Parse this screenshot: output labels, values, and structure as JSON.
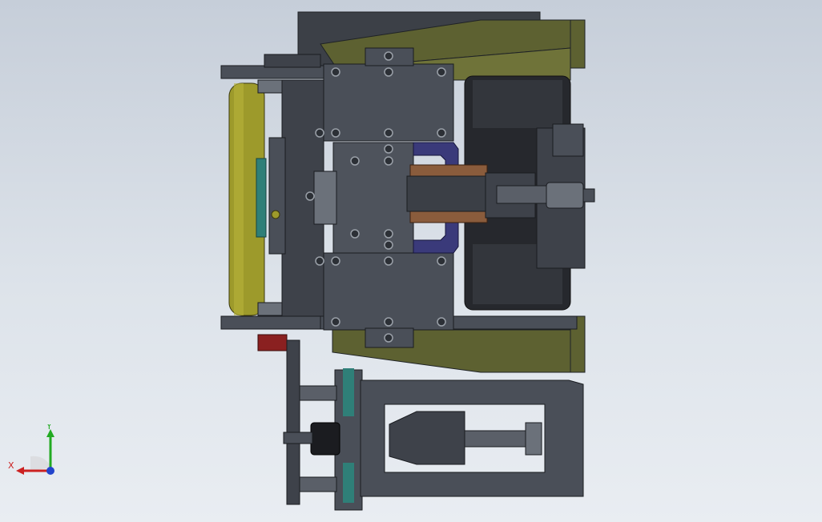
{
  "viewport": {
    "background_top": "#c6ced9",
    "background_bottom": "#e9edf2"
  },
  "model": {
    "colors": {
      "steel": "#4a4f58",
      "steel_dark": "#2c3036",
      "steel_light": "#6b717a",
      "olive": "#5d6131",
      "olive_light": "#6f7339",
      "yellow_roller": "#9d9a2b",
      "navy_bracket": "#3a3a7a",
      "copper_rod": "#8a5c3c",
      "teal_plate": "#2f7f78",
      "red_block": "#8a2020",
      "black_motor": "#1b1c20"
    }
  },
  "triad": {
    "x_label": "X",
    "y_label": "Y",
    "x_color": "#cc2222",
    "y_color": "#22aa22",
    "z_color": "#2244cc"
  }
}
